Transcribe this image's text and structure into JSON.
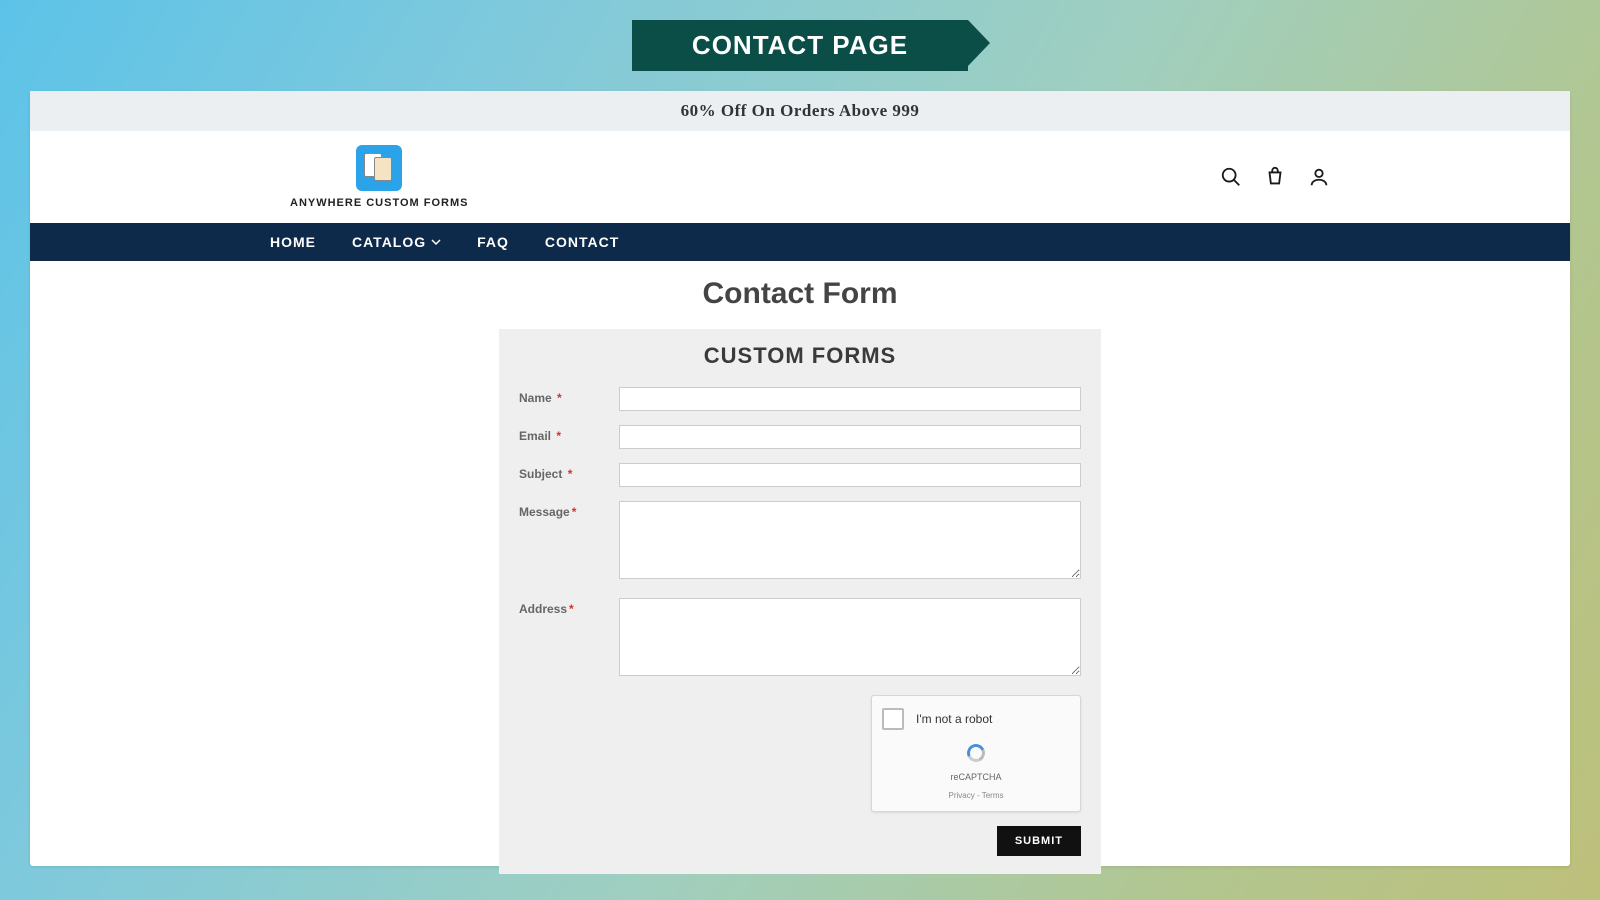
{
  "ribbon": {
    "label": "CONTACT PAGE"
  },
  "promo": {
    "text": "60% Off On Orders Above 999"
  },
  "logo": {
    "text": "ANYWHERE CUSTOM FORMS"
  },
  "nav": {
    "home": "HOME",
    "catalog": "CATALOG",
    "faq": "FAQ",
    "contact": "CONTACT"
  },
  "page": {
    "title": "Contact Form",
    "form_title": "CUSTOM FORMS"
  },
  "form": {
    "name_label": "Name",
    "email_label": "Email",
    "subject_label": "Subject",
    "message_label": "Message",
    "address_label": "Address",
    "star": "*"
  },
  "captcha": {
    "text": "I'm not a robot",
    "brand": "reCAPTCHA",
    "links": "Privacy - Terms"
  },
  "submit": {
    "label": "SUBMIT"
  }
}
